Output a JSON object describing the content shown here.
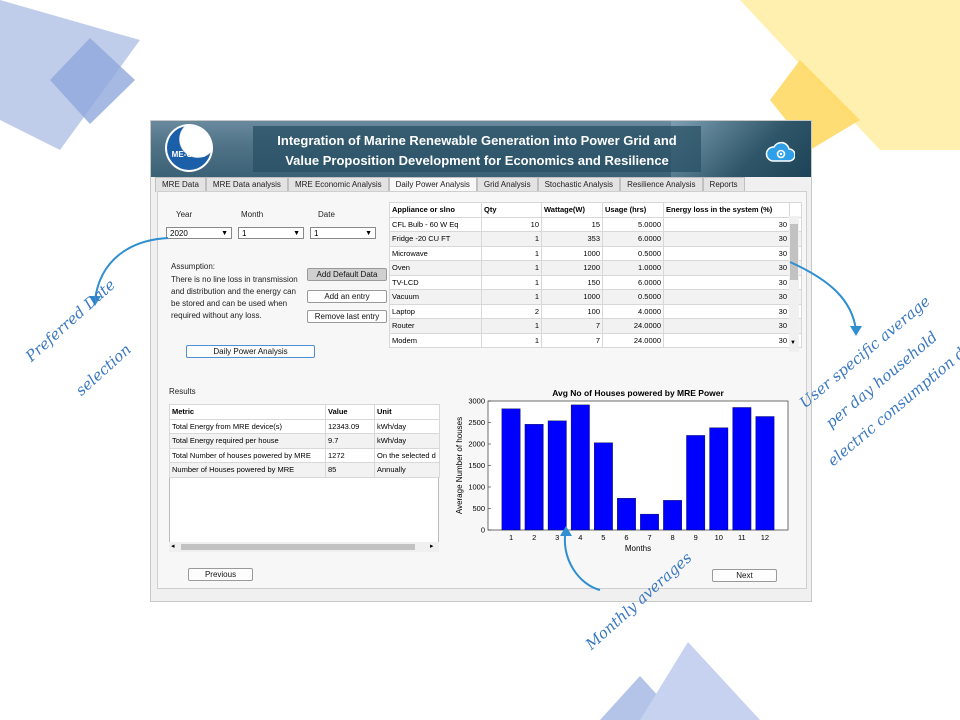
{
  "header": {
    "logo_text": "ME-GRID",
    "title_line1": "Integration of Marine Renewable Generation into Power Grid and",
    "title_line2": "Value Proposition Development for Economics and Resilience"
  },
  "tabs": [
    {
      "label": "MRE Data"
    },
    {
      "label": "MRE Data analysis"
    },
    {
      "label": "MRE Economic Analysis"
    },
    {
      "label": "Daily Power Analysis"
    },
    {
      "label": "Grid Analysis"
    },
    {
      "label": "Stochastic Analysis"
    },
    {
      "label": "Resilience Analysis"
    },
    {
      "label": "Reports"
    }
  ],
  "selectors": {
    "year_label": "Year",
    "year_value": "2020",
    "month_label": "Month",
    "month_value": "1",
    "date_label": "Date",
    "date_value": "1"
  },
  "assumption": {
    "title": "Assumption:",
    "lines": [
      "There is no line loss in transmission",
      "and distribution and the energy can",
      "be stored and can be used when",
      "required without any loss."
    ]
  },
  "buttons": {
    "add_default": "Add Default Data",
    "add_entry": "Add an entry",
    "remove_last": "Remove last entry",
    "daily_analysis": "Daily Power Analysis",
    "previous": "Previous",
    "next": "Next"
  },
  "appliance_table": {
    "headers": [
      "Appliance or slno",
      "Qty",
      "Wattage(W)",
      "Usage (hrs)",
      "Energy loss in the system (%)"
    ],
    "rows": [
      [
        "CFL Bulb - 60 W Eq",
        "10",
        "15",
        "5.0000",
        "30"
      ],
      [
        "Fridge -20 CU FT",
        "1",
        "353",
        "6.0000",
        "30"
      ],
      [
        "Microwave",
        "1",
        "1000",
        "0.5000",
        "30"
      ],
      [
        "Oven",
        "1",
        "1200",
        "1.0000",
        "30"
      ],
      [
        "TV-LCD",
        "1",
        "150",
        "6.0000",
        "30"
      ],
      [
        "Vacuum",
        "1",
        "1000",
        "0.5000",
        "30"
      ],
      [
        "Laptop",
        "2",
        "100",
        "4.0000",
        "30"
      ],
      [
        "Router",
        "1",
        "7",
        "24.0000",
        "30"
      ],
      [
        "Modem",
        "1",
        "7",
        "24.0000",
        "30"
      ]
    ]
  },
  "results": {
    "title": "Results",
    "headers": [
      "Metric",
      "Value",
      "Unit"
    ],
    "rows": [
      [
        "Total Energy from MRE device(s)",
        "12343.09",
        "kWh/day"
      ],
      [
        "Total Energy required per house",
        "9.7",
        "kWh/day"
      ],
      [
        "Total Number of houses powered by MRE",
        "1272",
        "On the selected d"
      ],
      [
        "Number of Houses powered by MRE",
        "85",
        "Annually"
      ]
    ]
  },
  "chart_data": {
    "type": "bar",
    "title": "Avg No of Houses powered by MRE Power",
    "xlabel": "Months",
    "ylabel": "Average Number of houses",
    "categories": [
      "1",
      "2",
      "3",
      "4",
      "5",
      "6",
      "7",
      "8",
      "9",
      "10",
      "11",
      "12"
    ],
    "values": [
      2820,
      2460,
      2540,
      2910,
      2030,
      740,
      370,
      690,
      2200,
      2380,
      2850,
      2640
    ],
    "ylim": [
      0,
      3000
    ],
    "yticks": [
      "0",
      "500",
      "1000",
      "1500",
      "2000",
      "2500",
      "3000"
    ],
    "bar_color": "#0000ff",
    "grid": false
  },
  "annotations": {
    "date": [
      "Preferred Date",
      "selection"
    ],
    "table": [
      "User specific average",
      "per day household",
      "electric consumption data"
    ],
    "monthly": "Monthly averages"
  },
  "colors": {
    "accent": "#3a78c0",
    "deco_blue": "#8fa8dc",
    "deco_yellow": "#ffd966"
  }
}
